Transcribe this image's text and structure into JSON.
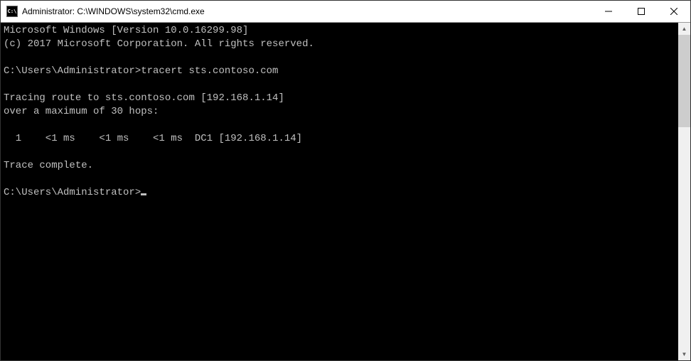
{
  "window": {
    "title": "Administrator: C:\\WINDOWS\\system32\\cmd.exe",
    "icon_label": "C:\\"
  },
  "terminal": {
    "lines": [
      "Microsoft Windows [Version 10.0.16299.98]",
      "(c) 2017 Microsoft Corporation. All rights reserved.",
      "",
      "C:\\Users\\Administrator>tracert sts.contoso.com",
      "",
      "Tracing route to sts.contoso.com [192.168.1.14]",
      "over a maximum of 30 hops:",
      "",
      "  1    <1 ms    <1 ms    <1 ms  DC1 [192.168.1.14]",
      "",
      "Trace complete.",
      "",
      "C:\\Users\\Administrator>"
    ]
  }
}
